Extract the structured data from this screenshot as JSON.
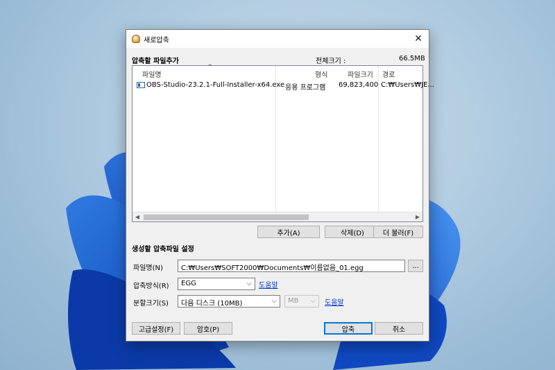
{
  "window": {
    "title": "새로압축",
    "close_glyph": "✕"
  },
  "files_section": {
    "label": "압축할 파일추가",
    "total_label": "전체크기 :",
    "total_value": "66.5MB"
  },
  "file_list": {
    "columns": [
      "파일명",
      "형식",
      "파일크기",
      "경로"
    ],
    "rows": [
      {
        "name": "OBS-Studio-23.2.1-Full-Installer-x64.exe",
        "type": "응용 프로그램",
        "size": "69,823,400",
        "path": "C:₩Users₩JE..."
      }
    ]
  },
  "list_buttons": {
    "add": "추가(A)",
    "delete": "삭제(D)",
    "more": "더 불러(F)"
  },
  "settings_section": {
    "label": "생성할 압축파일 설정"
  },
  "fields": {
    "filename_label": "파일명(N)",
    "filename_value": "C:₩Users₩SOFT2000₩Documents₩이름없음_01.egg",
    "browse": "...",
    "method_label": "압축방식(R)",
    "method_value": "EGG",
    "split_label": "분할크기(S)",
    "split_value": "다음 디스크 (10MB)",
    "unit_value": "MB",
    "help": "도움말"
  },
  "bottom_buttons": {
    "advanced": "고급설정(F)",
    "password": "암호(P)",
    "compress": "압축",
    "cancel": "취소"
  }
}
